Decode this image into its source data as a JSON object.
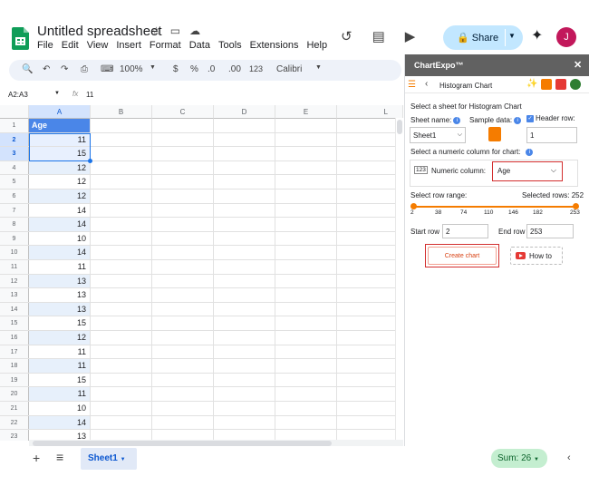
{
  "app": {
    "title": "Untitled spreadsheet",
    "menu": [
      "File",
      "Edit",
      "View",
      "Insert",
      "Format",
      "Data",
      "Tools",
      "Extensions",
      "Help"
    ],
    "share_label": "Share",
    "avatar_initial": "J"
  },
  "toolbar": {
    "zoom": "100%",
    "currency": "$",
    "percent": "%",
    "dec_decrease": ".0",
    "dec_increase": ".00",
    "number_format": "123",
    "font": "Calibri"
  },
  "formula_bar": {
    "name_box": "A2:A3",
    "fx": "fx",
    "value": "11"
  },
  "grid": {
    "columns": [
      "A",
      "B",
      "C",
      "D",
      "E",
      "L"
    ],
    "rows": [
      {
        "n": "1",
        "a": "Age"
      },
      {
        "n": "2",
        "a": "11"
      },
      {
        "n": "3",
        "a": "15"
      },
      {
        "n": "4",
        "a": "12"
      },
      {
        "n": "5",
        "a": "12"
      },
      {
        "n": "6",
        "a": "12"
      },
      {
        "n": "7",
        "a": "14"
      },
      {
        "n": "8",
        "a": "14"
      },
      {
        "n": "9",
        "a": "10"
      },
      {
        "n": "10",
        "a": "14"
      },
      {
        "n": "11",
        "a": "11"
      },
      {
        "n": "12",
        "a": "13"
      },
      {
        "n": "13",
        "a": "13"
      },
      {
        "n": "14",
        "a": "13"
      },
      {
        "n": "15",
        "a": "15"
      },
      {
        "n": "16",
        "a": "12"
      },
      {
        "n": "17",
        "a": "11"
      },
      {
        "n": "18",
        "a": "11"
      },
      {
        "n": "19",
        "a": "15"
      },
      {
        "n": "20",
        "a": "11"
      },
      {
        "n": "21",
        "a": "10"
      },
      {
        "n": "22",
        "a": "14"
      },
      {
        "n": "23",
        "a": "13"
      }
    ]
  },
  "bottom": {
    "sheet_tab": "Sheet1",
    "sum": "Sum: 26"
  },
  "panel": {
    "title": "ChartExpo™",
    "nav_title": "Histogram Chart",
    "select_sheet": "Select a sheet for Histogram Chart",
    "sheet_name_label": "Sheet name:",
    "sample_data_label": "Sample data:",
    "header_row_label": "Header row:",
    "sheet_value": "Sheet1",
    "header_row_value": "1",
    "select_numeric": "Select a numeric column for chart:",
    "numeric_icon": "123",
    "numeric_label": "Numeric column:",
    "numeric_value": "Age",
    "row_range_label": "Select row range:",
    "selected_rows": "Selected rows: 252",
    "ticks": [
      "2",
      "38",
      "74",
      "110",
      "146",
      "182",
      "253"
    ],
    "start_row_label": "Start row",
    "start_row_value": "2",
    "end_row_label": "End row",
    "end_row_value": "253",
    "create_chart": "Create chart",
    "how_to": "How to"
  },
  "colors": {
    "header_cell": "#4a86e8",
    "accent_orange": "#f57c00",
    "share_bg": "#c2e7ff",
    "sum_bg": "#c4eed0"
  }
}
